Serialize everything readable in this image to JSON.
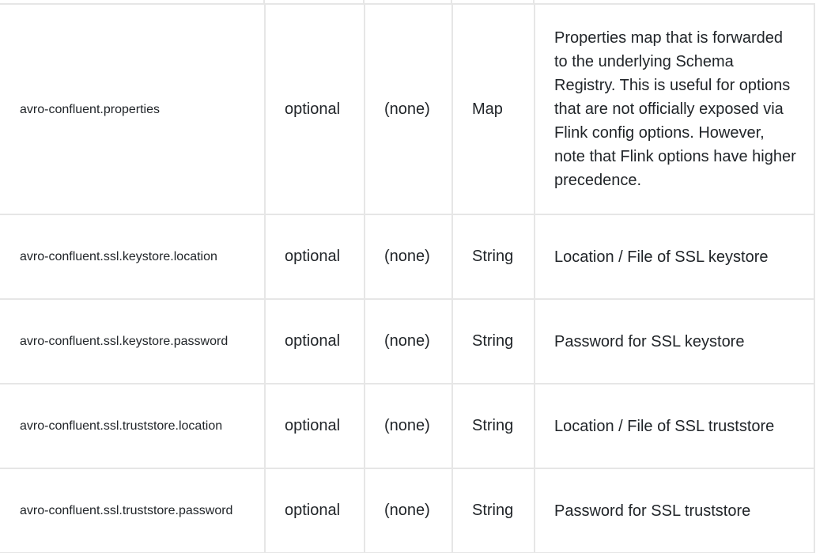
{
  "rows": [
    {
      "key": "avro-confluent.properties",
      "required": "optional",
      "default": "(none)",
      "type": "Map",
      "description": "Properties map that is forwarded to the underlying Schema Registry. This is useful for options that are not officially exposed via Flink config options. However, note that Flink options have higher precedence."
    },
    {
      "key": "avro-confluent.ssl.keystore.location",
      "required": "optional",
      "default": "(none)",
      "type": "String",
      "description": "Location / File of SSL keystore"
    },
    {
      "key": "avro-confluent.ssl.keystore.password",
      "required": "optional",
      "default": "(none)",
      "type": "String",
      "description": "Password for SSL keystore"
    },
    {
      "key": "avro-confluent.ssl.truststore.location",
      "required": "optional",
      "default": "(none)",
      "type": "String",
      "description": "Location / File of SSL truststore"
    },
    {
      "key": "avro-confluent.ssl.truststore.password",
      "required": "optional",
      "default": "(none)",
      "type": "String",
      "description": "Password for SSL truststore"
    }
  ]
}
